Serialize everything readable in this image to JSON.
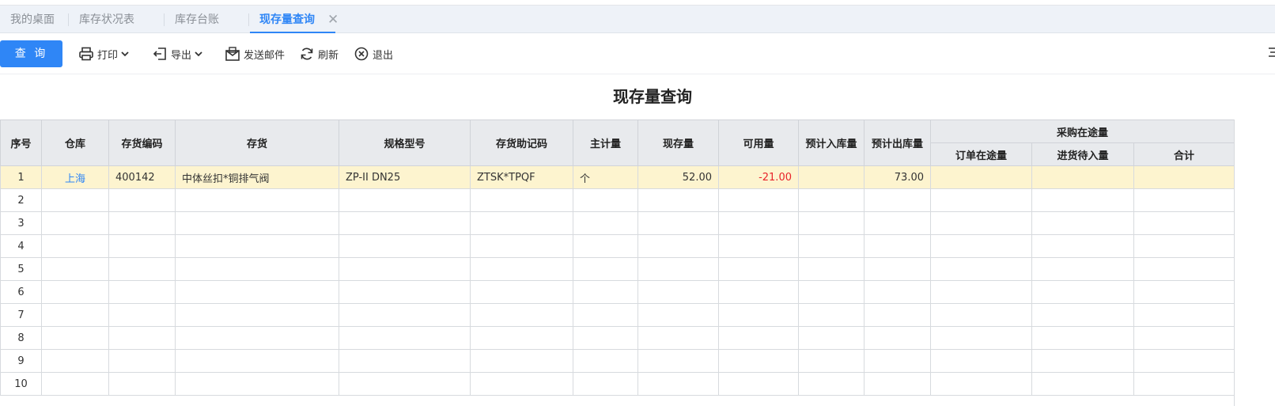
{
  "tabs": [
    {
      "label": "我的桌面"
    },
    {
      "label": "库存状况表"
    },
    {
      "label": "库存台账"
    },
    {
      "label": "现存量查询",
      "active": true
    }
  ],
  "tab_close": "✕",
  "toolbar": {
    "query": "查 询",
    "print": "打印",
    "export": "导出",
    "send_mail": "发送邮件",
    "refresh": "刷新",
    "exit": "退出"
  },
  "page_title": "现存量查询",
  "columns": {
    "seq": "序号",
    "warehouse": "仓库",
    "code": "存货编码",
    "item": "存货",
    "spec": "规格型号",
    "mnemonic": "存货助记码",
    "unit": "主计量",
    "onhand": "现存量",
    "available": "可用量",
    "expected_in": "预计入库量",
    "expected_out": "预计出库量",
    "purchase_transit": "采购在途量",
    "order_transit": "订单在途量",
    "pending_receipt": "进货待入量",
    "total": "合计"
  },
  "rows": [
    {
      "seq": "1",
      "warehouse": "上海",
      "code": "400142",
      "item": "中体丝扣*铜排气阀",
      "spec": "ZP-II DN25",
      "mnemonic": "ZTSK*TPQF",
      "unit": "个",
      "onhand": "52.00",
      "available": "-21.00",
      "expected_in": "",
      "expected_out": "73.00",
      "order_transit": "",
      "pending_receipt": "",
      "total": ""
    },
    {
      "seq": "2"
    },
    {
      "seq": "3"
    },
    {
      "seq": "4"
    },
    {
      "seq": "5"
    },
    {
      "seq": "6"
    },
    {
      "seq": "7"
    },
    {
      "seq": "8"
    },
    {
      "seq": "9"
    },
    {
      "seq": "10"
    }
  ],
  "colors": {
    "accent": "#2f86f6",
    "negative": "#e8232a",
    "highlight_row": "#fdf4cf",
    "header_bg": "#e8eaed"
  }
}
